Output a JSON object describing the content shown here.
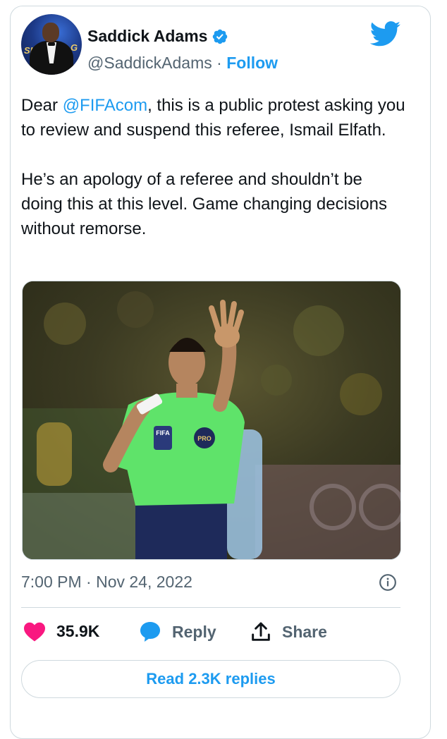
{
  "author": {
    "name": "Saddick Adams",
    "handle": "@SaddickAdams",
    "separator": " · ",
    "follow_label": "Follow",
    "verified": true,
    "avatar_text_left": "SLAG",
    "avatar_text_right": "G"
  },
  "tweet": {
    "text_prefix": "Dear ",
    "mention": "@FIFAcom",
    "text_rest": ", this is a public protest asking you to review and suspend this referee, Ismail Elfath.\n\nHe’s an apology of a referee and shouldn’t be doing this at this level. Game changing decisions without remorse.",
    "timestamp": "7:00 PM · Nov 24, 2022"
  },
  "media": {
    "badge_left": "FIFA",
    "badge_right": "PRO"
  },
  "actions": {
    "like_count": "35.9K",
    "reply_label": "Reply",
    "share_label": "Share"
  },
  "read_replies_label": "Read 2.3K replies",
  "colors": {
    "accent": "#1d9bf0",
    "like": "#f91880",
    "text": "#0f1419",
    "secondary": "#536471",
    "border": "#cfd9de",
    "jersey": "#5fe36a"
  }
}
